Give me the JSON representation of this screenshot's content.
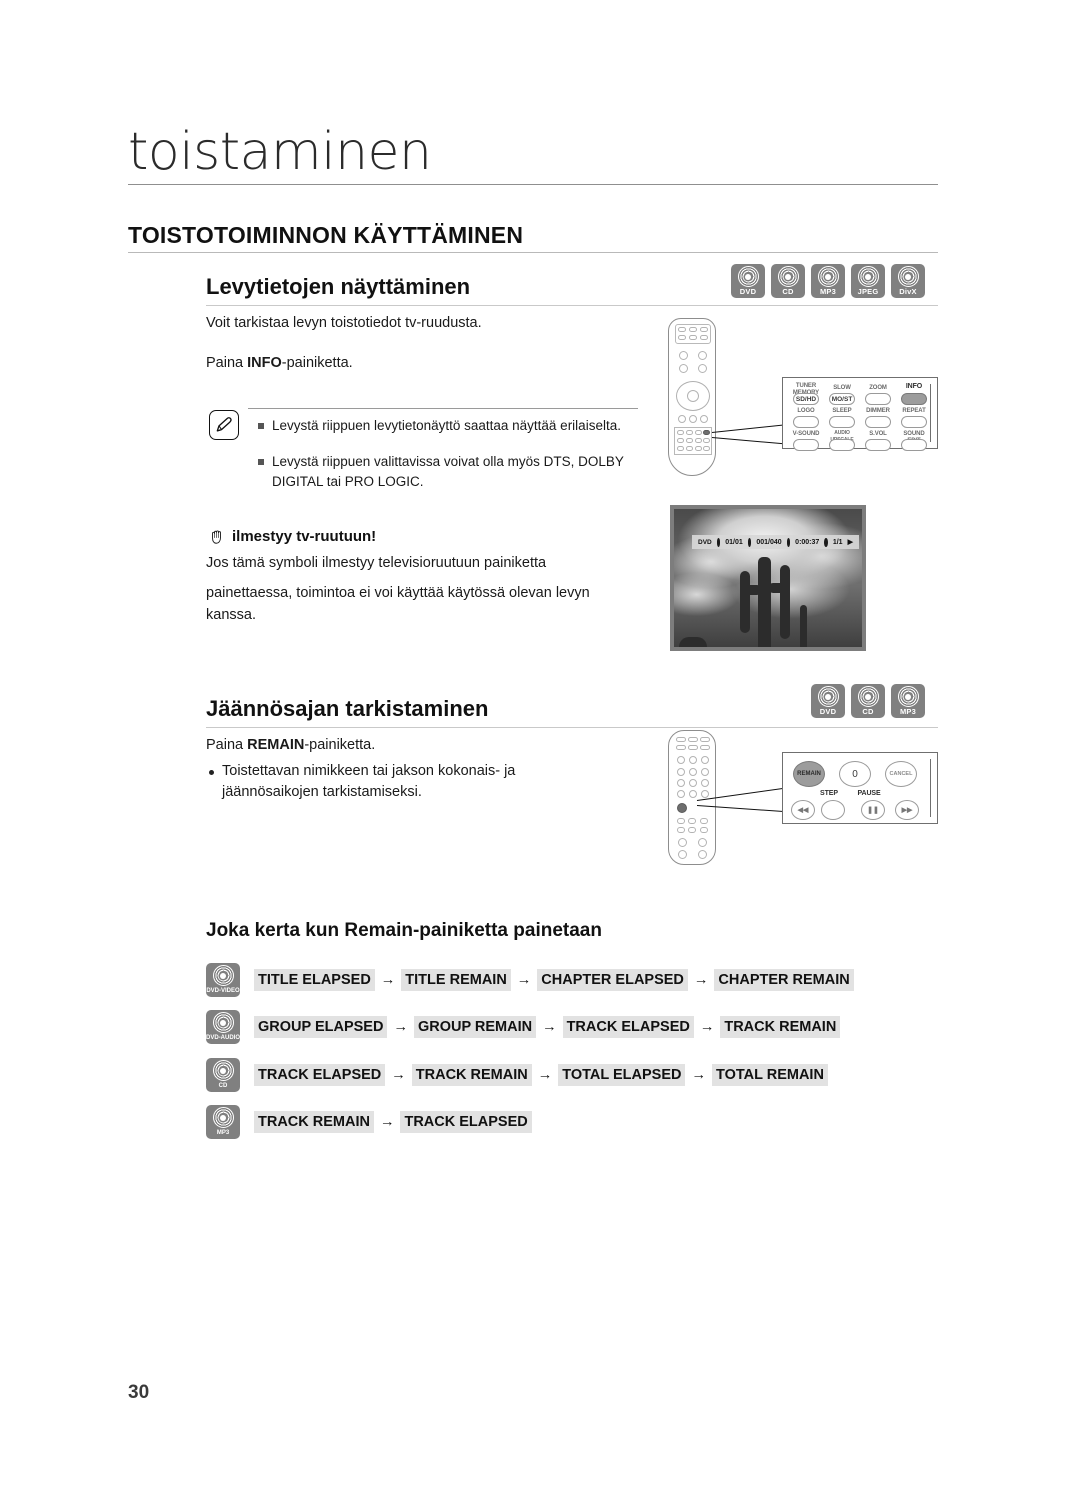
{
  "document": {
    "chapter_title": "toistaminen",
    "section_title": "TOISTOTOIMINNON KÄYTTÄMINEN",
    "page_number": "30"
  },
  "section_disc_info": {
    "heading": "Levytietojen näyttäminen",
    "disc_badges": [
      {
        "label": "DVD"
      },
      {
        "label": "CD"
      },
      {
        "label": "MP3"
      },
      {
        "label": "JPEG"
      },
      {
        "label": "DivX"
      }
    ],
    "intro": "Voit tarkistaa levyn toistotiedot tv-ruudusta.",
    "instruction_prefix": "Paina ",
    "instruction_bold": "INFO",
    "instruction_suffix": "-painiketta.",
    "note_icon": "pencil-note-icon",
    "notes": [
      "Levystä riippuen levytietonäyttö saattaa näyttää erilaiselta.",
      "Levystä riippuen valittavissa voivat olla myös DTS, DOLBY DIGITAL tai PRO LOGIC."
    ],
    "hand_note": {
      "icon": "hand-icon",
      "heading": "ilmestyy tv-ruutuun!",
      "line1": "Jos tämä symboli ilmestyy televisioruutuun painiketta",
      "line2": "painettaessa, toimintoa ei voi käyttää käytössä olevan levyn",
      "line3": "kanssa."
    }
  },
  "remote_info_callout": {
    "buttons_row1": [
      {
        "top_label": "TUNER MEMORY",
        "face": "SD/HD",
        "highlighted": false
      },
      {
        "top_label": "SLOW",
        "face": "MO/ST",
        "highlighted": false
      },
      {
        "top_label": "ZOOM",
        "face": "",
        "highlighted": false
      },
      {
        "top_label": "INFO",
        "face": "",
        "highlighted": true
      }
    ],
    "buttons_row2": [
      {
        "top_label": "LOGO",
        "face": ""
      },
      {
        "top_label": "SLEEP",
        "face": ""
      },
      {
        "top_label": "DIMMER",
        "face": ""
      },
      {
        "top_label": "REPEAT",
        "face": ""
      }
    ],
    "buttons_row3": [
      {
        "top_label": "V-SOUND",
        "face": ""
      },
      {
        "top_label": "AUDIO UPSCALE",
        "face": ""
      },
      {
        "top_label": "S.VOL",
        "face": ""
      },
      {
        "top_label": "SOUND EDIT",
        "face": ""
      }
    ]
  },
  "tv_screenshot": {
    "alt": "desert cactus scene",
    "osd": {
      "disc_type": "DVD",
      "title": "01/01",
      "chapter": "001/040",
      "time": "0:00:37",
      "angle": "1/1",
      "play_glyph": "▶"
    }
  },
  "section_remain": {
    "heading": "Jäännösajan tarkistaminen",
    "disc_badges": [
      {
        "label": "DVD"
      },
      {
        "label": "CD"
      },
      {
        "label": "MP3"
      }
    ],
    "instruction_prefix": "Paina ",
    "instruction_bold": "REMAIN",
    "instruction_suffix": "-painiketta.",
    "bullet_line1": "Toistettavan nimikkeen tai jakson kokonais- ja",
    "bullet_line2": "jäännösaikojen tarkistamiseksi."
  },
  "remote_remain_callout": {
    "top_buttons": [
      {
        "face": "REMAIN",
        "highlighted": true
      },
      {
        "face": "0",
        "highlighted": false
      },
      {
        "face": "CANCEL",
        "highlighted": false
      }
    ],
    "mid_labels": [
      "STEP",
      "PAUSE"
    ],
    "bottom_buttons": [
      {
        "glyph": "◀◀",
        "name": "prev-skip"
      },
      {
        "glyph": "",
        "name": "step"
      },
      {
        "glyph": "❚❚",
        "name": "pause"
      },
      {
        "glyph": "▶▶",
        "name": "next-skip"
      }
    ]
  },
  "sequence_section": {
    "heading": "Joka kerta kun Remain-painiketta painetaan",
    "rows": [
      {
        "disc": "DVD-VIDEO",
        "steps": [
          "TITLE ELAPSED",
          "TITLE REMAIN",
          "CHAPTER ELAPSED",
          "CHAPTER REMAIN"
        ]
      },
      {
        "disc": "DVD-AUDIO",
        "steps": [
          "GROUP ELAPSED",
          "GROUP REMAIN",
          "TRACK ELAPSED",
          "TRACK REMAIN"
        ]
      },
      {
        "disc": "CD",
        "steps": [
          "TRACK ELAPSED",
          "TRACK REMAIN",
          "TOTAL ELAPSED",
          "TOTAL REMAIN"
        ]
      },
      {
        "disc": "MP3",
        "steps": [
          "TRACK REMAIN",
          "TRACK ELAPSED"
        ]
      }
    ],
    "arrow": "→"
  },
  "colors": {
    "disc_badge": "#808080",
    "highlight_cell": "#e2e2e2",
    "rule": "#b9b9b9"
  }
}
